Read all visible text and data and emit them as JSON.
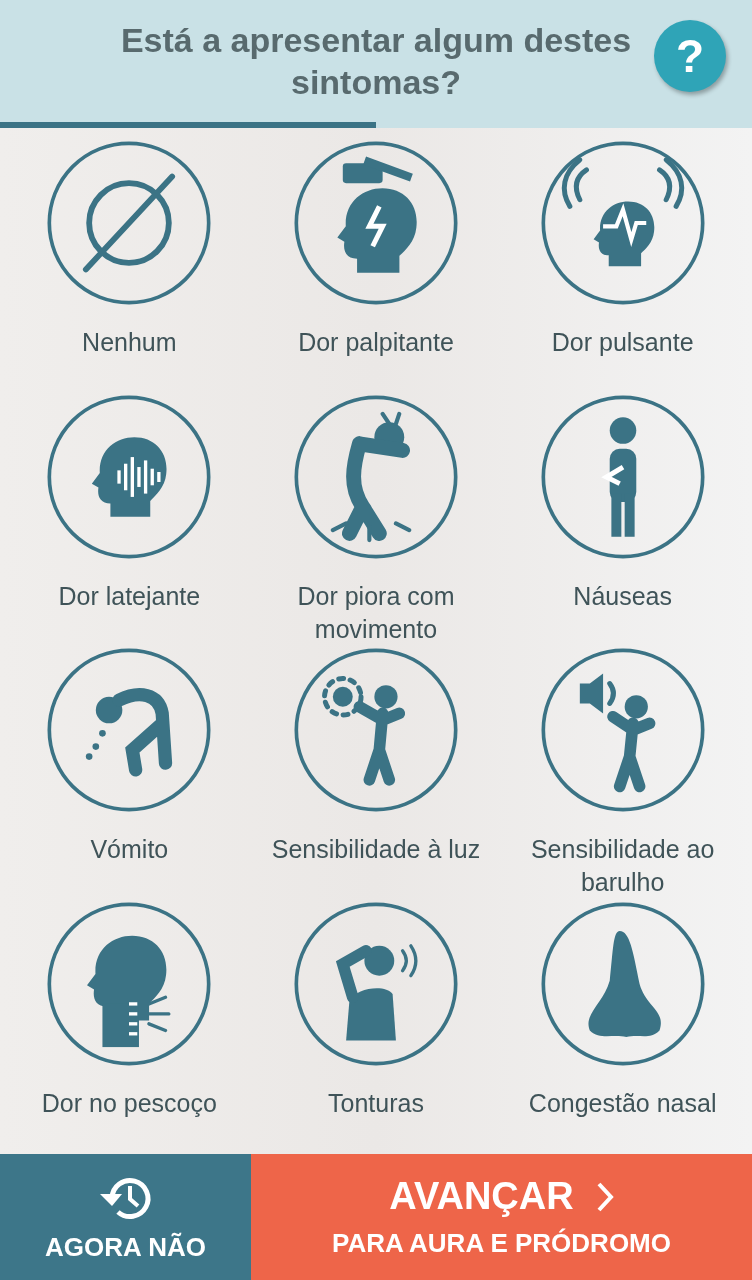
{
  "header": {
    "title": "Está a apresentar algum destes sintomas?",
    "help_button": "?"
  },
  "progress": {
    "level": 0.5
  },
  "symptoms": [
    {
      "kind": "none",
      "label": "Nenhum"
    },
    {
      "kind": "hammer",
      "label": "Dor palpitante"
    },
    {
      "kind": "pulse",
      "label": "Dor pulsante"
    },
    {
      "kind": "sound",
      "label": "Dor latejante"
    },
    {
      "kind": "movement",
      "label": "Dor piora com movimento"
    },
    {
      "kind": "nausea",
      "label": "Náuseas"
    },
    {
      "kind": "vomit",
      "label": "Vómito"
    },
    {
      "kind": "light",
      "label": "Sensibilidade à luz"
    },
    {
      "kind": "noise",
      "label": "Sensibilidade ao barulho"
    },
    {
      "kind": "neck",
      "label": "Dor no pescoço"
    },
    {
      "kind": "dizzy",
      "label": "Tonturas"
    },
    {
      "kind": "nose",
      "label": "Congestão nasal"
    }
  ],
  "footer": {
    "skip_button": "AGORA NÃO",
    "next_button": {
      "title": "AVANÇAR",
      "subtitle": "PARA AURA E PRÓDROMO"
    }
  }
}
